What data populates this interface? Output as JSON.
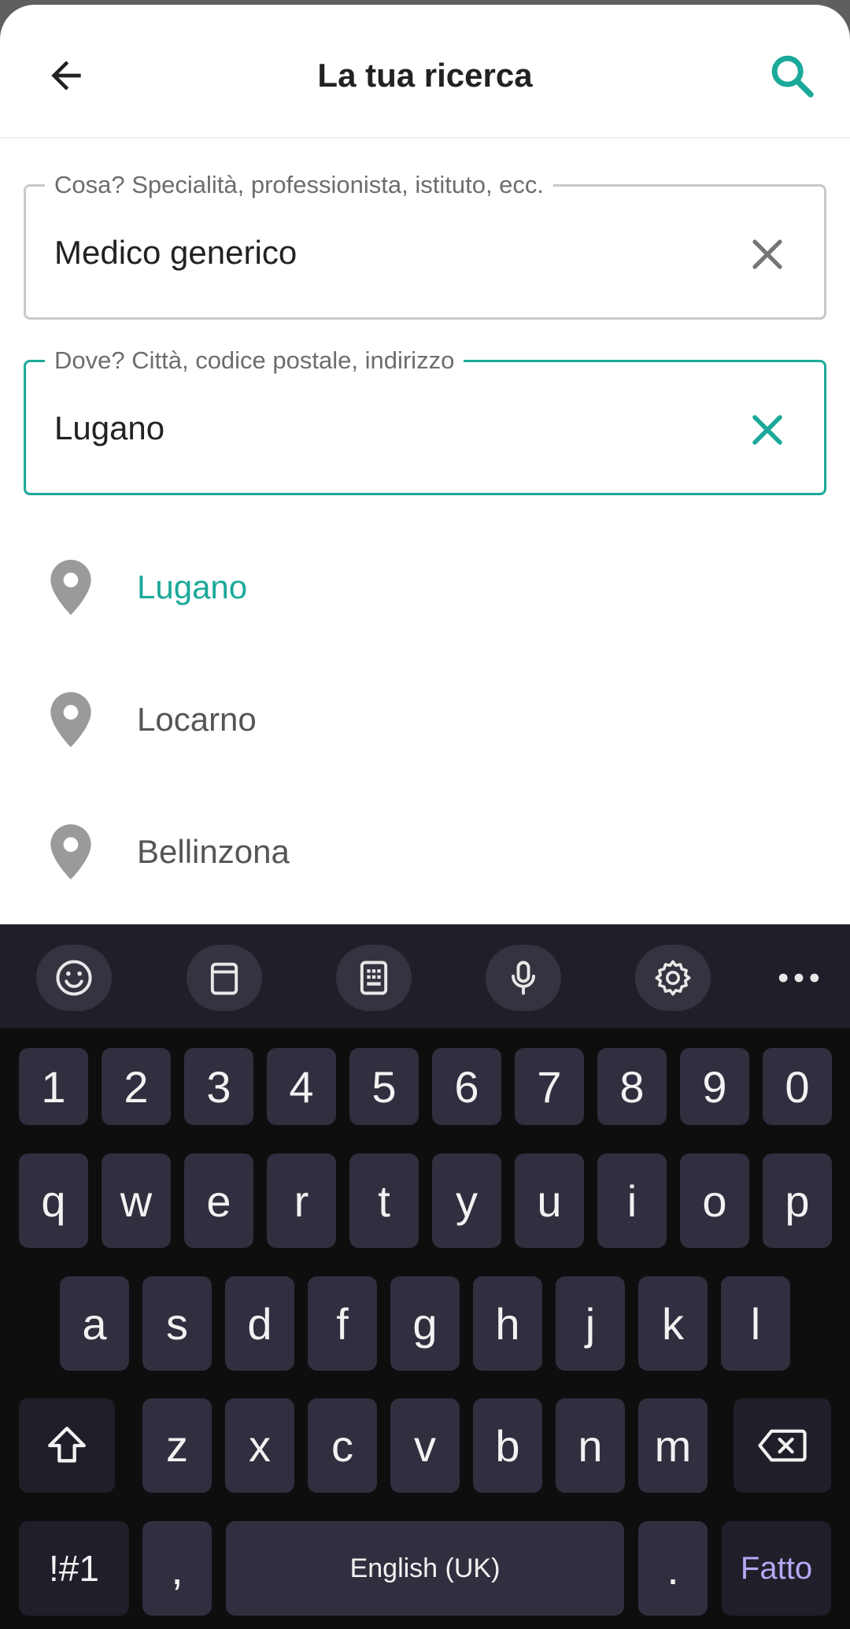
{
  "header": {
    "title": "La tua ricerca",
    "back_icon": "arrow-left-icon",
    "search_icon": "search-icon"
  },
  "colors": {
    "accent": "#1ba99a",
    "keyboard_bg": "#0e0e0f",
    "key_bg": "#302f3f",
    "done_text": "#b7a8f5"
  },
  "what_field": {
    "label": "Cosa? Specialità, professionista, istituto, ecc.",
    "value": "Medico generico"
  },
  "where_field": {
    "label": "Dove? Città, codice postale, indirizzo",
    "value": "Lugano"
  },
  "suggestions": [
    {
      "label": "Lugano",
      "icon": "location-pin-icon"
    },
    {
      "label": "Locarno",
      "icon": "location-pin-icon"
    },
    {
      "label": "Bellinzona",
      "icon": "location-pin-icon"
    }
  ],
  "keyboard": {
    "toolbar": [
      "emoji-icon",
      "clipboard-icon",
      "keypad-icon",
      "microphone-icon",
      "settings-icon",
      "more-icon"
    ],
    "row_numbers": [
      "1",
      "2",
      "3",
      "4",
      "5",
      "6",
      "7",
      "8",
      "9",
      "0"
    ],
    "row_1": [
      "q",
      "w",
      "e",
      "r",
      "t",
      "y",
      "u",
      "i",
      "o",
      "p"
    ],
    "row_2": [
      "a",
      "s",
      "d",
      "f",
      "g",
      "h",
      "j",
      "k",
      "l"
    ],
    "row_3": [
      "z",
      "x",
      "c",
      "v",
      "b",
      "n",
      "m"
    ],
    "symbols_label": "!#1",
    "comma": ",",
    "space_label": "English (UK)",
    "period": ".",
    "done_label": "Fatto"
  }
}
